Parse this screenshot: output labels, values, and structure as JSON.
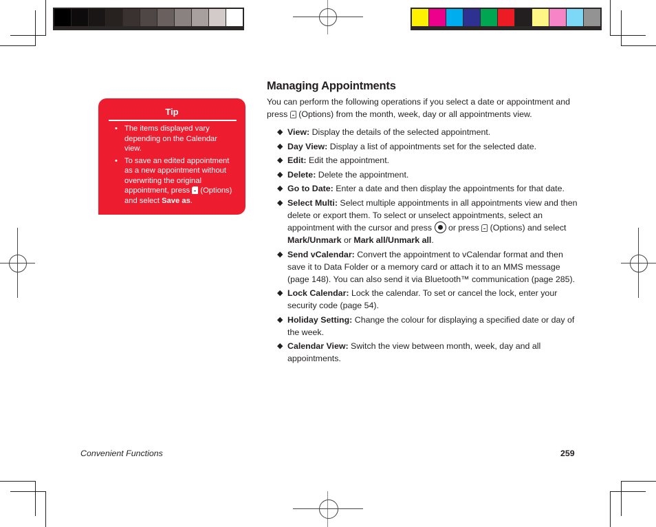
{
  "print_marks": {
    "grayscale_bar": [
      "#000000",
      "#0d0b0b",
      "#1a1615",
      "#272220",
      "#3a3230",
      "#4f4745",
      "#6a605d",
      "#8a8280",
      "#a8a09e",
      "#d3cbca",
      "#ffffff"
    ],
    "color_bar": [
      "#fff200",
      "#ec008c",
      "#00aeef",
      "#2e3192",
      "#00a651",
      "#ed1c24",
      "#231f20",
      "#fff685",
      "#f784c6",
      "#7dd8f7",
      "#939393"
    ]
  },
  "tip": {
    "title": "Tip",
    "bullet_glyph": "•",
    "items": [
      {
        "text": "The items displayed vary depending on the Calendar view."
      },
      {
        "text_before": "To save an edited appointment as a new appointment without overwriting the original appointment, press ",
        "key_icon": "soft-key-icon",
        "text_after": " (Options) and select ",
        "bold": "Save as",
        "end": "."
      }
    ],
    "accent_color": "#ed1c2e"
  },
  "section": {
    "title": "Managing Appointments",
    "intro_before": "You can perform the following operations if you select a date or appointment and press ",
    "intro_key_icon": "soft-key-icon",
    "intro_after": " (Options) from the month, week, day or all appointments view.",
    "bullet_glyph": "◆",
    "operations": [
      {
        "label": "View:",
        "text": " Display the details of the selected appointment."
      },
      {
        "label": "Day View:",
        "text": " Display a list of appointments set for the selected date."
      },
      {
        "label": "Edit:",
        "text": " Edit the appointment."
      },
      {
        "label": "Delete:",
        "text": " Delete the appointment."
      },
      {
        "label": "Go to Date:",
        "text": " Enter a date and then display the appointments for that date."
      },
      {
        "label": "Select Multi:",
        "text": " Select multiple appointments in all appointments view and then delete or export them. To select or unselect appointments, select an appointment with the cursor and press ",
        "center_key_icon": "center-key-icon",
        "text2": " or press ",
        "soft_key_icon": "soft-key-icon",
        "text3": " (Options) and select ",
        "bold1": "Mark/Unmark",
        "text4": " or ",
        "bold2": "Mark all/Unmark all",
        "end": "."
      },
      {
        "label": "Send vCalendar:",
        "text": " Convert the appointment to vCalendar format and then save it to Data Folder or a memory card or attach it to an MMS message (page 148). You can also send it via Bluetooth™ communication (page 285)."
      },
      {
        "label": "Lock Calendar:",
        "text": " Lock the calendar. To set or cancel the lock, enter your security code (page 54)."
      },
      {
        "label": "Holiday Setting:",
        "text": " Change the colour for displaying a specified date or day of the week."
      },
      {
        "label": "Calendar View:",
        "text": " Switch the view between month, week, day and all appointments."
      }
    ]
  },
  "footer": {
    "section_name": "Convenient Functions",
    "page_number": "259"
  }
}
